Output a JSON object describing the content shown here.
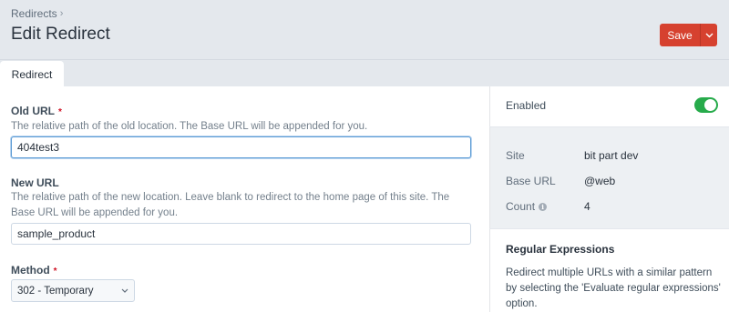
{
  "breadcrumb": {
    "label": "Redirects"
  },
  "page": {
    "title": "Edit Redirect"
  },
  "toolbar": {
    "save_label": "Save"
  },
  "tabs": [
    {
      "label": "Redirect",
      "active": true
    }
  ],
  "form": {
    "old_url": {
      "label": "Old URL",
      "required_mark": "*",
      "help": "The relative path of the old location. The Base URL will be appended for you.",
      "value": "404test3"
    },
    "new_url": {
      "label": "New URL",
      "help": "The relative path of the new location. Leave blank to redirect to the home page of this site. The Base URL will be appended for you.",
      "value": "sample_product"
    },
    "method": {
      "label": "Method",
      "required_mark": "*",
      "selected": "302 - Temporary"
    }
  },
  "sidebar": {
    "enabled": {
      "label": "Enabled",
      "on": true
    },
    "meta": [
      {
        "key": "Site",
        "value": "bit part dev",
        "info": false
      },
      {
        "key": "Base URL",
        "value": "@web",
        "info": false
      },
      {
        "key": "Count",
        "value": "4",
        "info": true
      }
    ],
    "regex": {
      "title": "Regular Expressions",
      "text": "Redirect multiple URLs with a similar pattern by selecting the 'Evaluate regular expressions' option."
    }
  },
  "colors": {
    "accent": "#d6412f",
    "toggle_on": "#27ab4b",
    "focus": "#5b9bd5"
  },
  "icons": {
    "breadcrumb_separator": "chevron-right-icon",
    "save_menu": "chevron-down-icon",
    "select_arrow": "chevron-down-icon",
    "count_info": "info-icon"
  }
}
